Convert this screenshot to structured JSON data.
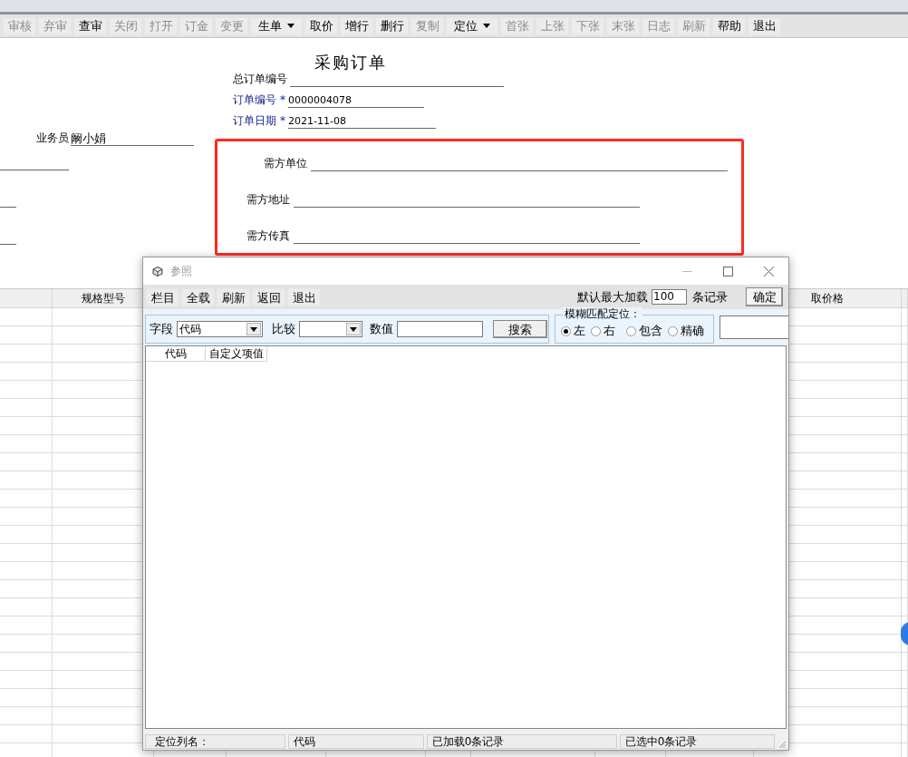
{
  "toolbar": [
    {
      "label": "审核",
      "kind": "button",
      "enabled": false
    },
    {
      "label": "弃审",
      "kind": "button",
      "enabled": false
    },
    {
      "label": "查审",
      "kind": "button",
      "enabled": true
    },
    {
      "label": "关闭",
      "kind": "button",
      "enabled": false
    },
    {
      "label": "打开",
      "kind": "button",
      "enabled": false
    },
    {
      "label": "订金",
      "kind": "button",
      "enabled": false
    },
    {
      "label": "变更",
      "kind": "button",
      "enabled": false
    },
    {
      "label": "生单",
      "kind": "dropdown",
      "enabled": true
    },
    {
      "label": "取价",
      "kind": "button",
      "enabled": true
    },
    {
      "label": "增行",
      "kind": "button",
      "enabled": true
    },
    {
      "label": "删行",
      "kind": "button",
      "enabled": true
    },
    {
      "label": "复制",
      "kind": "button",
      "enabled": false
    },
    {
      "label": "定位",
      "kind": "dropdown",
      "enabled": true
    },
    {
      "label": "首张",
      "kind": "button",
      "enabled": false
    },
    {
      "label": "上张",
      "kind": "button",
      "enabled": false
    },
    {
      "label": "下张",
      "kind": "button",
      "enabled": false
    },
    {
      "label": "末张",
      "kind": "button",
      "enabled": false
    },
    {
      "label": "日志",
      "kind": "button",
      "enabled": false
    },
    {
      "label": "刷新",
      "kind": "button",
      "enabled": false
    },
    {
      "label": "帮助",
      "kind": "button",
      "enabled": true
    },
    {
      "label": "退出",
      "kind": "button",
      "enabled": true
    }
  ],
  "form": {
    "title": "采购订单",
    "fields": [
      {
        "label": "总订单编号",
        "required": false
      },
      {
        "label": "订单编号",
        "required": true,
        "marker": "*",
        "value": "0000004078"
      },
      {
        "label": "订单日期",
        "required": true,
        "marker": "*",
        "value": "2021-11-08"
      }
    ],
    "salesperson": {
      "label": "业务员",
      "value": "阚小娟"
    },
    "buyer_fields": [
      {
        "label": "需方单位"
      },
      {
        "label": "需方地址"
      },
      {
        "label": "需方传真"
      }
    ]
  },
  "grid": {
    "headers": [
      "规格型号",
      "取价格"
    ]
  },
  "dialog": {
    "title": "参照",
    "toolbar": [
      "栏目",
      "全载",
      "刷新",
      "返回",
      "退出"
    ],
    "max_load": {
      "label": "默认最大加载",
      "value": "100",
      "suffix": "条记录"
    },
    "confirm": "确定",
    "search": {
      "field_label": "字段",
      "field_value": "代码",
      "compare_label": "比较",
      "value_label": "数值",
      "button": "搜索"
    },
    "fuzzy": {
      "title": "模糊匹配定位：",
      "options": [
        {
          "label": "左",
          "selected": true
        },
        {
          "label": "右",
          "selected": false
        },
        {
          "label": "包含",
          "selected": false
        },
        {
          "label": "精确",
          "selected": false
        }
      ]
    },
    "list_columns": [
      "代码",
      "自定义项值"
    ],
    "status": [
      "定位列名：",
      "代码",
      "已加载0条记录",
      "已选中0条记录"
    ]
  }
}
